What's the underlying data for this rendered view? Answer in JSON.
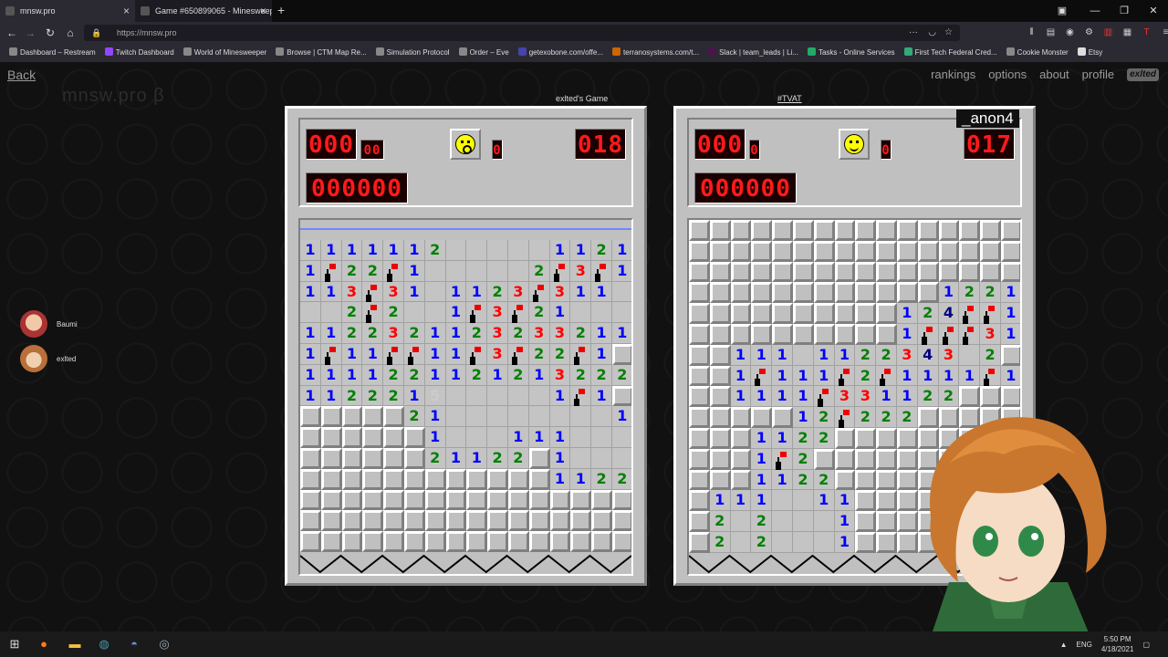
{
  "browser": {
    "tabs": [
      {
        "label": "mnsw.pro",
        "active": true
      },
      {
        "label": "Game #650899065 - Minesweep",
        "active": false
      }
    ],
    "url": "https://mnsw.pro",
    "bookmarks": [
      "Dashboard – Restream",
      "Twitch Dashboard",
      "World of Minesweeper",
      "Browse | CTM Map Re...",
      "Simulation Protocol",
      "Order – Eve",
      "getexobone.com/offe...",
      "terranosystems.com/t...",
      "Slack | team_leads | Li...",
      "Tasks - Online Services",
      "First Tech Federal Cred...",
      "Cookie Monster",
      "Etsy"
    ]
  },
  "site": {
    "back": "Back",
    "logo": "mnsw.pro β",
    "nav": [
      "rankings",
      "options",
      "about",
      "profile"
    ],
    "badge": "exlted"
  },
  "players": [
    {
      "name": "Baumi"
    },
    {
      "name": "exlted"
    }
  ],
  "left_game": {
    "title": "exlted's Game",
    "mines": "000",
    "small1": "00",
    "small2": "0",
    "timer": "018",
    "score": "000000",
    "face": "surprised",
    "rows": [
      "1111112.....1121",
      "1F22F1.....2F3F1",
      "113F31.1123F311.",
      "..2F2..1F3F21...",
      "11223211232332111",
      "1F11FF11F3F22F1",
      "1111221121213222",
      "1122215.....1F1",
      "HHHHH21........111",
      "HHHHHH1...111...",
      "HHHHHH21122H1...",
      "HHHHHHHHHHHH1122",
      "HHHHHHHHHHHHHHHH",
      "HHHHHHHHHHHHHHHH",
      "HHHHHHHHHHHHHHHH"
    ]
  },
  "right_game": {
    "title": "#TVAT",
    "overlay_name": "_anon4",
    "mines": "000",
    "small1": "0",
    "small2": "0",
    "timer": "017",
    "score": "000000",
    "face": "smile",
    "rows": [
      "HHHHHHHHHHHHHHHH",
      "HHHHHHHHHHHHHHHH",
      "HHHHHHHHHHHHHHHH",
      "HHHHHHHHHHHH1221",
      "HHHHHHHHHH124FF1",
      "HHHHHHHHHH1FFF31",
      "HH111.1122343 2H",
      "HH1F111F2F1111F1",
      "HH1111F331122HHH",
      "HHHHH12F222HHHHH",
      "HHH1122HHHHHHHHH",
      "HHH1F2HHHHHHHHHH",
      "HHH1122HHHHHHHHH",
      "H111..11HHHHHHHH",
      "H2.2...1HHHHHHHH",
      "H2.2...1HHHHHHHH"
    ]
  },
  "taskbar": {
    "lang": "ENG",
    "time": "5:50 PM",
    "date": "4/18/2021"
  },
  "colors": {
    "n1": "#0000ff",
    "n2": "#008000",
    "n3": "#ff0000",
    "n4": "#000080",
    "lcd": "#ff1a1a"
  }
}
